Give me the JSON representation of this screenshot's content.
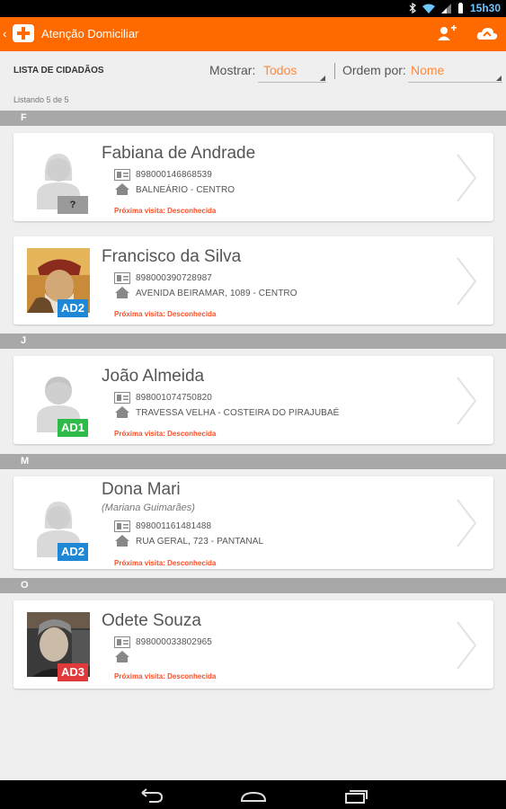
{
  "status_bar": {
    "time": "15h30"
  },
  "action_bar": {
    "title": "Atenção Domiciliar"
  },
  "filters": {
    "list_title": "LISTA DE CIDADÃOS",
    "show_label": "Mostrar:",
    "show_value": "Todos",
    "order_label": "Ordem por:",
    "order_value": "Nome"
  },
  "count_text": "Listando 5 de 5",
  "colors": {
    "accent": "#ff6a00",
    "next_visit": "#ff4d24",
    "ad1": "#2fbb4a",
    "ad2": "#1e88d6",
    "ad3": "#e03a3a"
  },
  "sections": [
    {
      "letter": "F",
      "citizens": [
        {
          "name": "Fabiana de Andrade",
          "alias": "",
          "card": "898000146868539",
          "address": "BALNEÁRIO - CENTRO",
          "next_visit": "Próxima visita: Desconhecida",
          "badge": "?",
          "avatar": "female-placeholder"
        },
        {
          "name": "Francisco da Silva",
          "alias": "",
          "card": "898000390728987",
          "address": "AVENIDA BEIRAMAR, 1089 - CENTRO",
          "next_visit": "Próxima visita: Desconhecida",
          "badge": "AD2",
          "avatar": "photo"
        }
      ]
    },
    {
      "letter": "J",
      "citizens": [
        {
          "name": "João Almeida",
          "alias": "",
          "card": "898001074750820",
          "address": "TRAVESSA VELHA - COSTEIRA DO PIRAJUBAÉ",
          "next_visit": "Próxima visita: Desconhecida",
          "badge": "AD1",
          "avatar": "male-placeholder"
        }
      ]
    },
    {
      "letter": "M",
      "citizens": [
        {
          "name": "Dona Mari",
          "alias": "(Mariana Guimarães)",
          "card": "898001161481488",
          "address": "RUA GERAL, 723 - PANTANAL",
          "next_visit": "Próxima visita: Desconhecida",
          "badge": "AD2",
          "avatar": "female-placeholder"
        }
      ]
    },
    {
      "letter": "O",
      "citizens": [
        {
          "name": "Odete Souza",
          "alias": "",
          "card": "898000033802965",
          "address": "",
          "next_visit": "Próxima visita: Desconhecida",
          "badge": "AD3",
          "avatar": "photo"
        }
      ]
    }
  ]
}
